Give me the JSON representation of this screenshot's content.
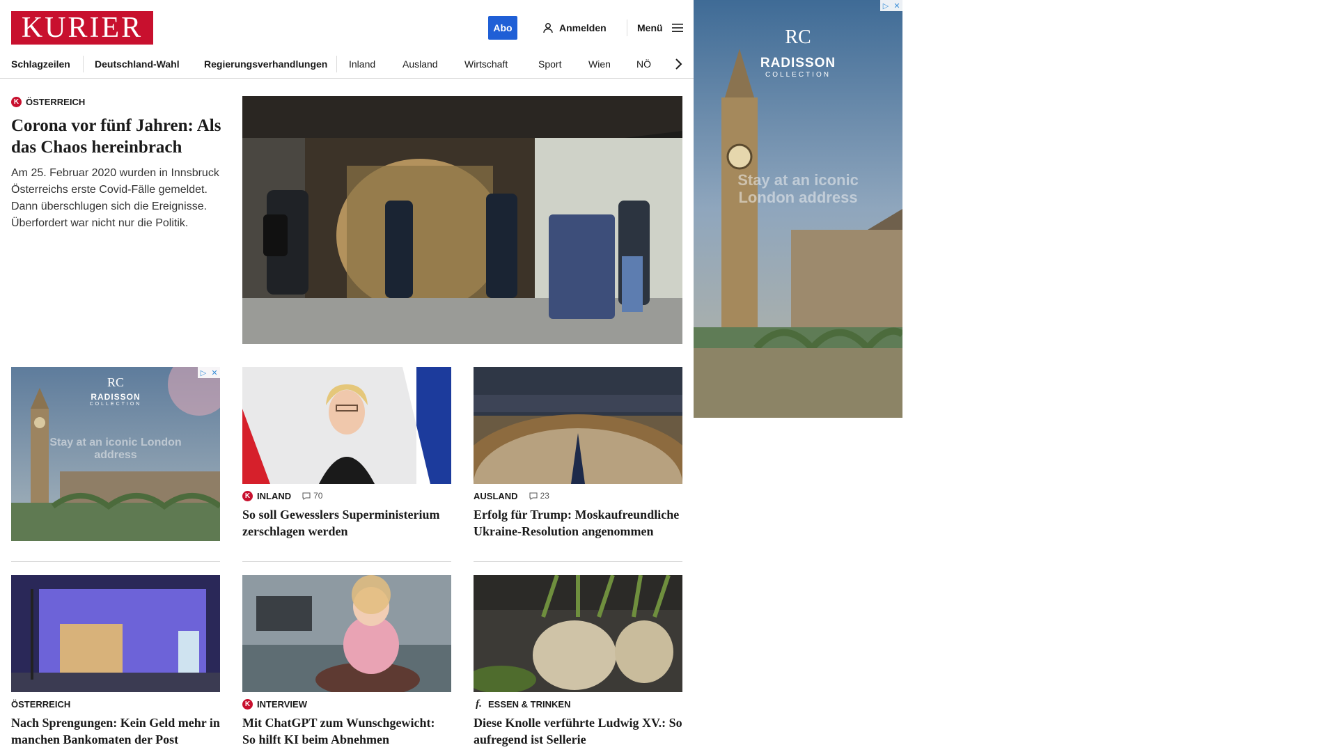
{
  "header": {
    "logo_text": "KURIER",
    "abo_label": "Abo",
    "login_label": "Anmelden",
    "menu_label": "Menü"
  },
  "nav": {
    "items": [
      "Schlagzeilen",
      "Deutschland-Wahl",
      "Regierungsverhandlungen",
      "Inland",
      "Ausland",
      "Wirtschaft",
      "Sport",
      "Wien",
      "NÖ"
    ]
  },
  "lead": {
    "kicker": "ÖSTERREICH",
    "headline": "Corona vor fünf Jahren: Als das Chaos hereinbrach",
    "teaser": "Am 25. Februar 2020 wurden in Innsbruck Österreichs erste Covid-Fälle gemeldet. Dann überschlugen sich die Ereignisse. Überfordert war nicht nur die Politik."
  },
  "cards": [
    {
      "kicker": "INLAND",
      "comments": "70",
      "headline": "So soll Gewesslers Superministerium zerschlagen werden"
    },
    {
      "kicker": "AUSLAND",
      "comments": "23",
      "headline": "Erfolg für Trump: Moskaufreundliche Ukraine-Resolution angenommen"
    },
    {
      "kicker": "ÖSTERREICH",
      "headline": "Nach Sprengungen: Kein Geld mehr in manchen Bankomaten der Post"
    },
    {
      "kicker": "INTERVIEW",
      "headline": "Mit ChatGPT zum Wunschgewicht: So hilft KI beim Abnehmen"
    },
    {
      "kicker": "ESSEN & TRINKEN",
      "headline": "Diese Knolle verführte Ludwig XV.: So aufregend ist Sellerie"
    }
  ],
  "ads": {
    "side": {
      "logo": "RC",
      "brand": "RADISSON",
      "sub": "COLLECTION",
      "tagline": "Stay at an iconic London address"
    },
    "inline": {
      "logo": "RC",
      "brand": "RADISSON",
      "sub": "COLLECTION",
      "tagline": "Stay at an iconic London address"
    }
  },
  "colors": {
    "brand_red": "#c8102e",
    "abo_blue": "#1f5fd6"
  },
  "icons": {
    "login": "user-icon",
    "menu": "hamburger-icon",
    "nav_more": "chevron-right-icon",
    "comments": "comment-icon",
    "ad_choices": "ad-choices-icon",
    "ad_close": "close-icon"
  }
}
